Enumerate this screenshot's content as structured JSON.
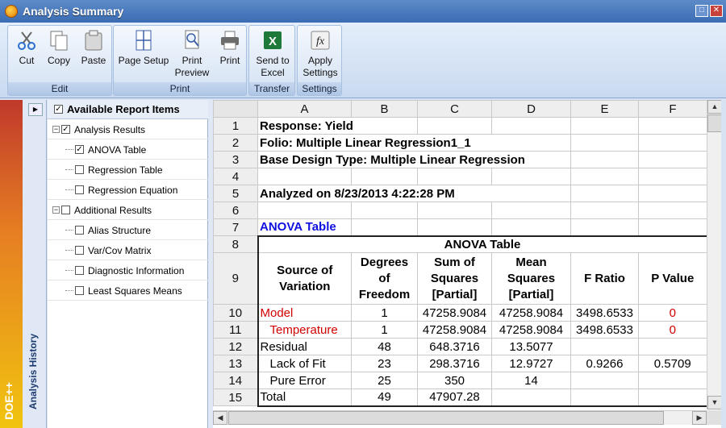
{
  "window": {
    "title": "Analysis Summary",
    "minimize": "□",
    "close": "✕"
  },
  "ribbon": {
    "groups": [
      {
        "label": "Edit",
        "buttons": [
          "Cut",
          "Copy",
          "Paste"
        ]
      },
      {
        "label": "Print",
        "buttons": [
          "Page Setup",
          "Print Preview",
          "Print"
        ]
      },
      {
        "label": "Transfer",
        "buttons": [
          "Send to Excel"
        ]
      },
      {
        "label": "Settings",
        "buttons": [
          "Apply Settings"
        ]
      }
    ],
    "cut": "Cut",
    "copy": "Copy",
    "paste": "Paste",
    "page_setup": "Page Setup",
    "print_preview_1": "Print",
    "print_preview_2": "Preview",
    "print": "Print",
    "send_excel_1": "Send to",
    "send_excel_2": "Excel",
    "apply_1": "Apply",
    "apply_2": "Settings",
    "edit_label": "Edit",
    "print_label": "Print",
    "transfer_label": "Transfer",
    "settings_label": "Settings"
  },
  "sidebar": {
    "history_label": "Analysis History",
    "logo": "DOE++"
  },
  "tree": {
    "header": "Available Report Items",
    "analysis_results": "Analysis Results",
    "anova_table": "ANOVA Table",
    "regression_table": "Regression Table",
    "regression_equation": "Regression Equation",
    "additional_results": "Additional Results",
    "alias_structure": "Alias Structure",
    "var_cov": "Var/Cov Matrix",
    "diagnostic": "Diagnostic Information",
    "least_squares": "Least Squares Means"
  },
  "sheet": {
    "columns": [
      "A",
      "B",
      "C",
      "D",
      "E",
      "F"
    ],
    "rows": [
      "1",
      "2",
      "3",
      "4",
      "5",
      "6",
      "7",
      "8",
      "9",
      "10",
      "11",
      "12",
      "13",
      "14",
      "15"
    ],
    "response": "Response: Yield",
    "folio": "Folio: Multiple Linear Regression1_1",
    "base_design": "Base Design Type: Multiple Linear Regression",
    "analyzed": "Analyzed on 8/23/2013 4:22:28 PM",
    "anova_link": "ANOVA Table",
    "anova_title": "ANOVA Table",
    "headers": {
      "source_1": "Source of",
      "source_2": "Variation",
      "dof_1": "Degrees",
      "dof_2": "of",
      "dof_3": "Freedom",
      "ss_1": "Sum of",
      "ss_2": "Squares",
      "ss_3": "[Partial]",
      "ms_1": "Mean",
      "ms_2": "Squares",
      "ms_3": "[Partial]",
      "f": "F Ratio",
      "p": "P Value"
    },
    "table": [
      {
        "source": "Model",
        "dof": "1",
        "ss": "47258.9084",
        "ms": "47258.9084",
        "f": "3498.6533",
        "p": "0"
      },
      {
        "source": "Temperature",
        "dof": "1",
        "ss": "47258.9084",
        "ms": "47258.9084",
        "f": "3498.6533",
        "p": "0"
      },
      {
        "source": "Residual",
        "dof": "48",
        "ss": "648.3716",
        "ms": "13.5077",
        "f": "",
        "p": ""
      },
      {
        "source": "Lack of Fit",
        "dof": "23",
        "ss": "298.3716",
        "ms": "12.9727",
        "f": "0.9266",
        "p": "0.5709"
      },
      {
        "source": "Pure Error",
        "dof": "25",
        "ss": "350",
        "ms": "14",
        "f": "",
        "p": ""
      },
      {
        "source": "Total",
        "dof": "49",
        "ss": "47907.28",
        "ms": "",
        "f": "",
        "p": ""
      }
    ]
  }
}
